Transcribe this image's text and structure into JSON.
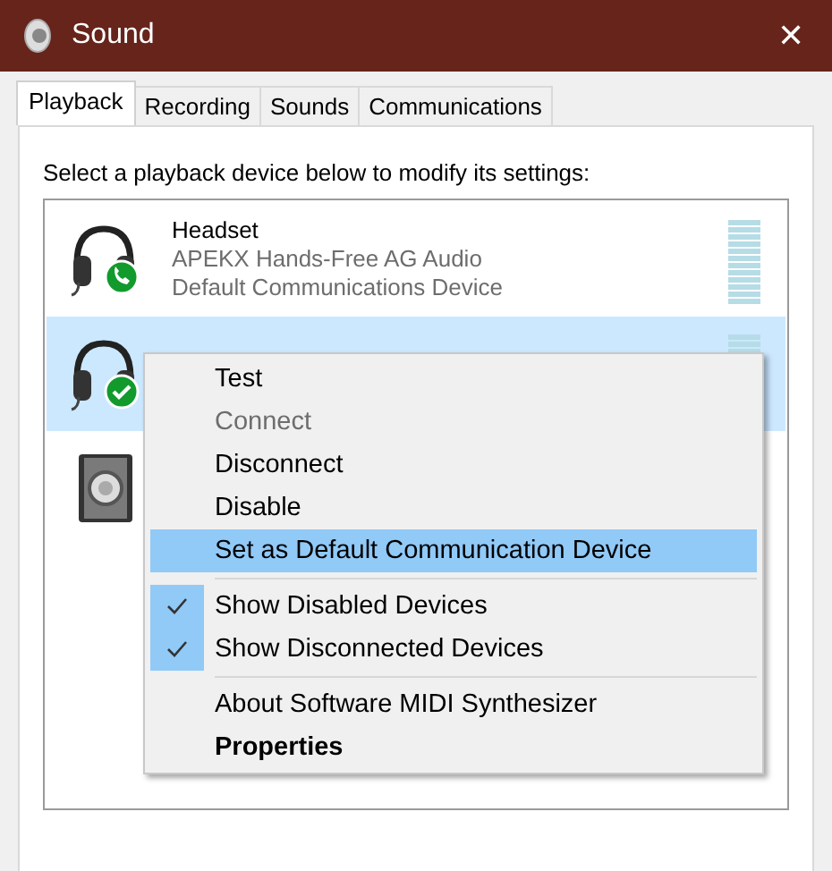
{
  "window": {
    "title": "Sound",
    "close": "✕"
  },
  "tabs": [
    {
      "label": "Playback",
      "selected": true
    },
    {
      "label": "Recording",
      "selected": false
    },
    {
      "label": "Sounds",
      "selected": false
    },
    {
      "label": "Communications",
      "selected": false
    }
  ],
  "instruction": "Select a playback device below to modify its settings:",
  "devices": [
    {
      "kind": "headset-phone",
      "name": "Headset",
      "description": "APEKX Hands-Free AG Audio",
      "status": "Default Communications Device",
      "selected": false
    },
    {
      "kind": "headset-check",
      "selected": true
    },
    {
      "kind": "speaker",
      "selected": false
    }
  ],
  "context_menu": [
    {
      "kind": "item",
      "label": "Test",
      "disabled": false,
      "checked": false,
      "selected": false,
      "default": false
    },
    {
      "kind": "item",
      "label": "Connect",
      "disabled": true,
      "checked": false,
      "selected": false,
      "default": false
    },
    {
      "kind": "item",
      "label": "Disconnect",
      "disabled": false,
      "checked": false,
      "selected": false,
      "default": false
    },
    {
      "kind": "item",
      "label": "Disable",
      "disabled": false,
      "checked": false,
      "selected": false,
      "default": false
    },
    {
      "kind": "item",
      "label": "Set as Default Communication Device",
      "disabled": false,
      "checked": false,
      "selected": true,
      "default": false
    },
    {
      "kind": "separator"
    },
    {
      "kind": "item",
      "label": "Show Disabled Devices",
      "disabled": false,
      "checked": true,
      "selected": false,
      "default": false
    },
    {
      "kind": "item",
      "label": "Show Disconnected Devices",
      "disabled": false,
      "checked": true,
      "selected": false,
      "default": false
    },
    {
      "kind": "separator"
    },
    {
      "kind": "item",
      "label": "About Software MIDI Synthesizer",
      "disabled": false,
      "checked": false,
      "selected": false,
      "default": false
    },
    {
      "kind": "item",
      "label": "Properties",
      "disabled": false,
      "checked": false,
      "selected": false,
      "default": true
    }
  ]
}
